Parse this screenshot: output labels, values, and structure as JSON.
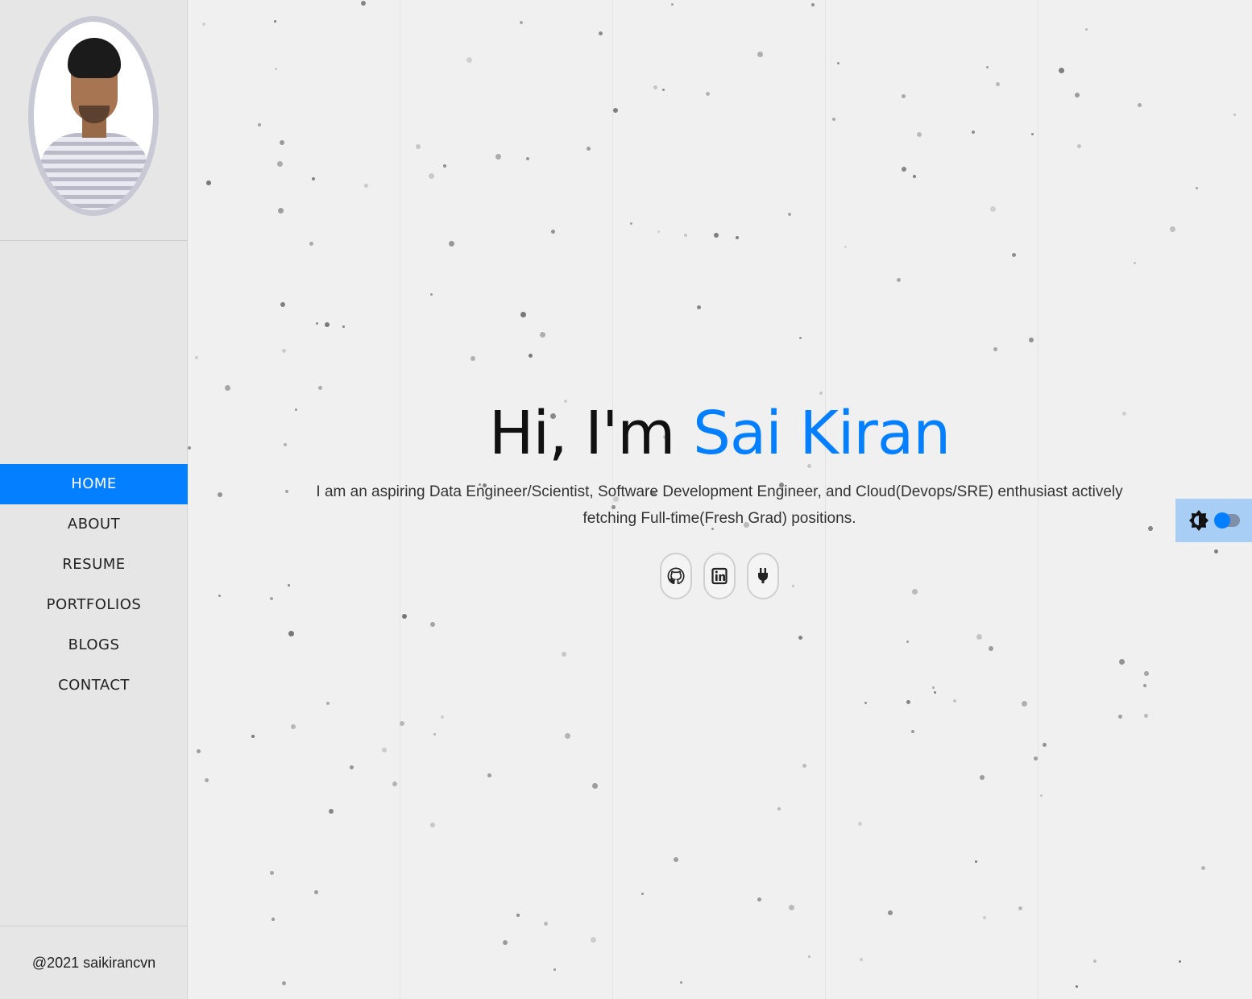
{
  "profile": {
    "photo_alt": ""
  },
  "nav": {
    "items": [
      {
        "label": "HOME",
        "active": true
      },
      {
        "label": "ABOUT",
        "active": false
      },
      {
        "label": "RESUME",
        "active": false
      },
      {
        "label": "PORTFOLIOS",
        "active": false
      },
      {
        "label": "BLOGS",
        "active": false
      },
      {
        "label": "CONTACT",
        "active": false
      }
    ]
  },
  "footer": {
    "copyright": "@2021 saikirancvn"
  },
  "hero": {
    "greeting": "Hi, I'm",
    "name": "Sai Kiran",
    "intro_start": "I am an aspiring ",
    "intro_roles": "Data Engineer/Scientist, Software Development Engineer, and Cloud(Devops/SRE)",
    "intro_middle": " enthusiast actively fetching ",
    "intro_target": "Full-time(Fresh Grad)",
    "intro_end": " positions."
  },
  "socials": [
    {
      "icon": "github-icon"
    },
    {
      "icon": "linkedin-icon"
    },
    {
      "icon": "plug-icon"
    }
  ],
  "theme": {
    "icon": "brightness-icon",
    "dark_mode": false
  },
  "colors": {
    "accent": "#037fff",
    "background": "#f0f0f0",
    "sidebar": "#e6e6e6"
  }
}
